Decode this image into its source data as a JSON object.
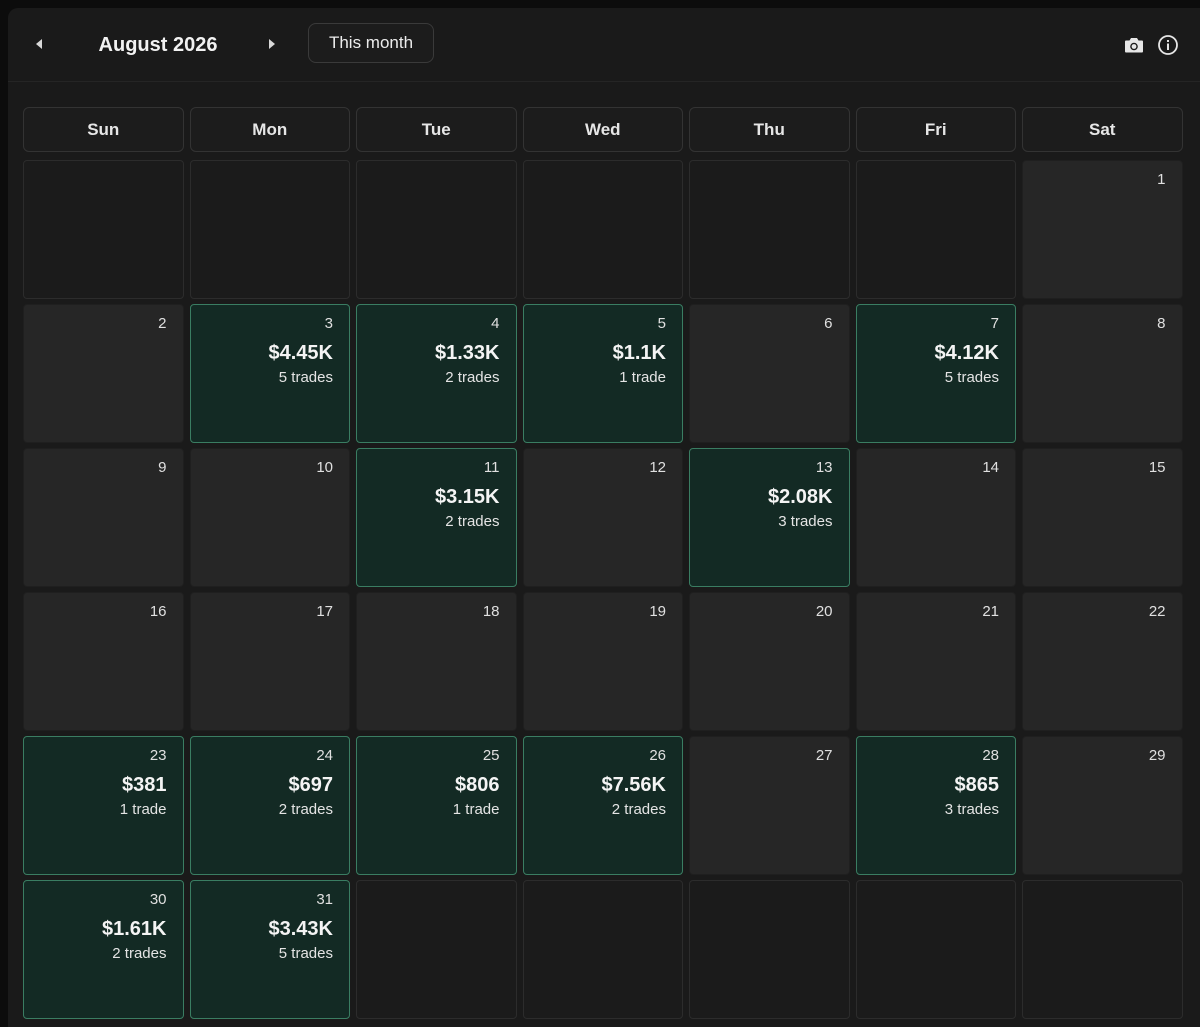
{
  "header": {
    "month_label": "August 2026",
    "this_month_label": "This month",
    "prev_icon": "chevron-left-icon",
    "next_icon": "chevron-right-icon",
    "camera_icon": "camera-icon",
    "info_icon": "info-icon"
  },
  "colors": {
    "background": "#1a1a1a",
    "profit_cell": "#132a24",
    "profit_border": "#3a7d62",
    "day_cell": "#262626"
  },
  "weekdays": [
    "Sun",
    "Mon",
    "Tue",
    "Wed",
    "Thu",
    "Fri",
    "Sat"
  ],
  "cells": [
    {
      "day": "",
      "pnl": "",
      "trades": "",
      "status": "blank"
    },
    {
      "day": "",
      "pnl": "",
      "trades": "",
      "status": "blank"
    },
    {
      "day": "",
      "pnl": "",
      "trades": "",
      "status": "blank"
    },
    {
      "day": "",
      "pnl": "",
      "trades": "",
      "status": "blank"
    },
    {
      "day": "",
      "pnl": "",
      "trades": "",
      "status": "blank"
    },
    {
      "day": "",
      "pnl": "",
      "trades": "",
      "status": "blank"
    },
    {
      "day": "1",
      "pnl": "",
      "trades": "",
      "status": "none"
    },
    {
      "day": "2",
      "pnl": "",
      "trades": "",
      "status": "none"
    },
    {
      "day": "3",
      "pnl": "$4.45K",
      "trades": "5 trades",
      "status": "profit"
    },
    {
      "day": "4",
      "pnl": "$1.33K",
      "trades": "2 trades",
      "status": "profit"
    },
    {
      "day": "5",
      "pnl": "$1.1K",
      "trades": "1 trade",
      "status": "profit"
    },
    {
      "day": "6",
      "pnl": "",
      "trades": "",
      "status": "none"
    },
    {
      "day": "7",
      "pnl": "$4.12K",
      "trades": "5 trades",
      "status": "profit"
    },
    {
      "day": "8",
      "pnl": "",
      "trades": "",
      "status": "none"
    },
    {
      "day": "9",
      "pnl": "",
      "trades": "",
      "status": "none"
    },
    {
      "day": "10",
      "pnl": "",
      "trades": "",
      "status": "none"
    },
    {
      "day": "11",
      "pnl": "$3.15K",
      "trades": "2 trades",
      "status": "profit"
    },
    {
      "day": "12",
      "pnl": "",
      "trades": "",
      "status": "none"
    },
    {
      "day": "13",
      "pnl": "$2.08K",
      "trades": "3 trades",
      "status": "profit"
    },
    {
      "day": "14",
      "pnl": "",
      "trades": "",
      "status": "none"
    },
    {
      "day": "15",
      "pnl": "",
      "trades": "",
      "status": "none"
    },
    {
      "day": "16",
      "pnl": "",
      "trades": "",
      "status": "none"
    },
    {
      "day": "17",
      "pnl": "",
      "trades": "",
      "status": "none"
    },
    {
      "day": "18",
      "pnl": "",
      "trades": "",
      "status": "none"
    },
    {
      "day": "19",
      "pnl": "",
      "trades": "",
      "status": "none"
    },
    {
      "day": "20",
      "pnl": "",
      "trades": "",
      "status": "none"
    },
    {
      "day": "21",
      "pnl": "",
      "trades": "",
      "status": "none"
    },
    {
      "day": "22",
      "pnl": "",
      "trades": "",
      "status": "none"
    },
    {
      "day": "23",
      "pnl": "$381",
      "trades": "1 trade",
      "status": "profit"
    },
    {
      "day": "24",
      "pnl": "$697",
      "trades": "2 trades",
      "status": "profit"
    },
    {
      "day": "25",
      "pnl": "$806",
      "trades": "1 trade",
      "status": "profit"
    },
    {
      "day": "26",
      "pnl": "$7.56K",
      "trades": "2 trades",
      "status": "profit"
    },
    {
      "day": "27",
      "pnl": "",
      "trades": "",
      "status": "none"
    },
    {
      "day": "28",
      "pnl": "$865",
      "trades": "3 trades",
      "status": "profit"
    },
    {
      "day": "29",
      "pnl": "",
      "trades": "",
      "status": "none"
    },
    {
      "day": "30",
      "pnl": "$1.61K",
      "trades": "2 trades",
      "status": "profit"
    },
    {
      "day": "31",
      "pnl": "$3.43K",
      "trades": "5 trades",
      "status": "profit"
    },
    {
      "day": "",
      "pnl": "",
      "trades": "",
      "status": "blank"
    },
    {
      "day": "",
      "pnl": "",
      "trades": "",
      "status": "blank"
    },
    {
      "day": "",
      "pnl": "",
      "trades": "",
      "status": "blank"
    },
    {
      "day": "",
      "pnl": "",
      "trades": "",
      "status": "blank"
    },
    {
      "day": "",
      "pnl": "",
      "trades": "",
      "status": "blank"
    }
  ]
}
